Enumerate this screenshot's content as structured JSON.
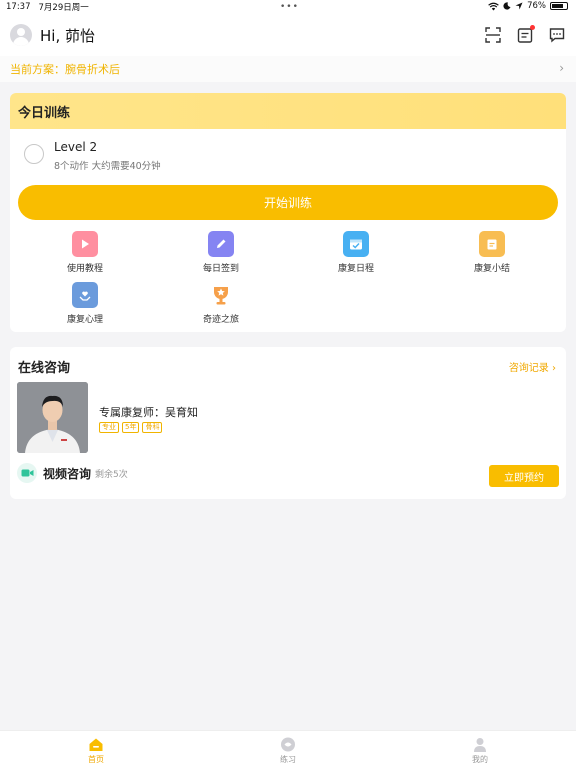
{
  "status_bar": {
    "time": "17:37",
    "date": "7月29日周一",
    "battery": "76%",
    "battery_level": 0.76
  },
  "header": {
    "greeting": "Hi, 茆怡",
    "icons": [
      "scan-icon",
      "checklist-icon",
      "message-icon"
    ]
  },
  "plan": {
    "text": "当前方案：腕骨折术后"
  },
  "training": {
    "title": "今日训练",
    "level_title": "Level 2",
    "level_sub": "8个动作  大约需要40分钟",
    "start_label": "开始训练",
    "grid": [
      {
        "label": "使用教程",
        "icon": "play-tutorial-icon",
        "color": "#ff7b8a"
      },
      {
        "label": "每日签到",
        "icon": "pen-checkin-icon",
        "color": "#7d7cf0"
      },
      {
        "label": "康复日程",
        "icon": "calendar-check-icon",
        "color": "#3aa8f0"
      },
      {
        "label": "康复小结",
        "icon": "clipboard-summary-icon",
        "color": "#f7b84a"
      },
      {
        "label": "康复心理",
        "icon": "heart-hands-icon",
        "color": "#5b8fd9"
      },
      {
        "label": "奇迹之旅",
        "icon": "trophy-star-icon",
        "color": "#f59a3c"
      }
    ]
  },
  "consult": {
    "title": "在线咨询",
    "record_link": "咨询记录",
    "doctor_name": "专属康复师：吴育知",
    "tags": [
      "专业",
      "5年",
      "骨科"
    ],
    "video_label": "视频咨询",
    "video_remaining": "剩余5次",
    "book_label": "立即预约"
  },
  "tabbar": {
    "tabs": [
      {
        "label": "首页",
        "icon": "home-icon",
        "active": true
      },
      {
        "label": "练习",
        "icon": "practice-icon",
        "active": false
      },
      {
        "label": "我的",
        "icon": "profile-icon",
        "active": false
      }
    ]
  },
  "colors": {
    "accent": "#f9bd00",
    "accent_text": "#f0a800",
    "card_header": "#ffe58a"
  }
}
